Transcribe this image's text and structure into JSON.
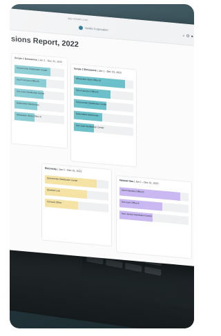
{
  "browser": {
    "url": "app.reclaim.com"
  },
  "app": {
    "logo_text": "Verdia Corporation",
    "tools": "⌕ ⚙ ●"
  },
  "report": {
    "title": "sions Report, 2022"
  },
  "panels": [
    {
      "title": "Scope 1 Emissions",
      "subtitle": "| Jan 1 - Dec 31, 2022",
      "color": "#7cc7cf",
      "rows": [
        {
          "label": "Sacramento Distribution Center",
          "value": 0.72
        },
        {
          "label": "San Francisco Office B",
          "value": 0.64
        },
        {
          "label": "San Jose Distribution Center",
          "value": 0.58
        },
        {
          "label": "Bakersfield Warehouse",
          "value": 0.46
        },
        {
          "label": "Milwaukee Store Office B",
          "value": 0.4
        }
      ]
    },
    {
      "title": "Scope 2 Emissions",
      "subtitle": "| Jan 1 - Dec 31, 2022",
      "color": "#6cc0c9",
      "rows": [
        {
          "label": "Milwaukee Store Office B",
          "value": 0.86
        },
        {
          "label": "San Francisco Office B",
          "value": 0.62
        },
        {
          "label": "Sacramento Distribution Center",
          "value": 0.55
        },
        {
          "label": "Bakersfield Warehouse",
          "value": 0.48
        },
        {
          "label": "San Jose Distribution Center",
          "value": 0.34
        }
      ]
    },
    {
      "title": "Electricity",
      "subtitle": "| Jan 1 - Dec 31, 2022",
      "color": "#f5e3a6",
      "rows": [
        {
          "label": "Sacramento Distribution Center",
          "value": 0.82
        },
        {
          "label": "Stockton Lab",
          "value": 0.66
        },
        {
          "label": "Concord Office",
          "value": 0.52
        }
      ]
    },
    {
      "title": "Natural Gas",
      "subtitle": "| Jan 1 - Dec 31, 2022",
      "color": "#c9b8f1",
      "rows": [
        {
          "label": "San Francisco Office B",
          "value": 0.88
        },
        {
          "label": "San Jose Office B",
          "value": 0.62
        },
        {
          "label": "New Jersey Distribution Center",
          "value": 0.48
        }
      ]
    }
  ]
}
